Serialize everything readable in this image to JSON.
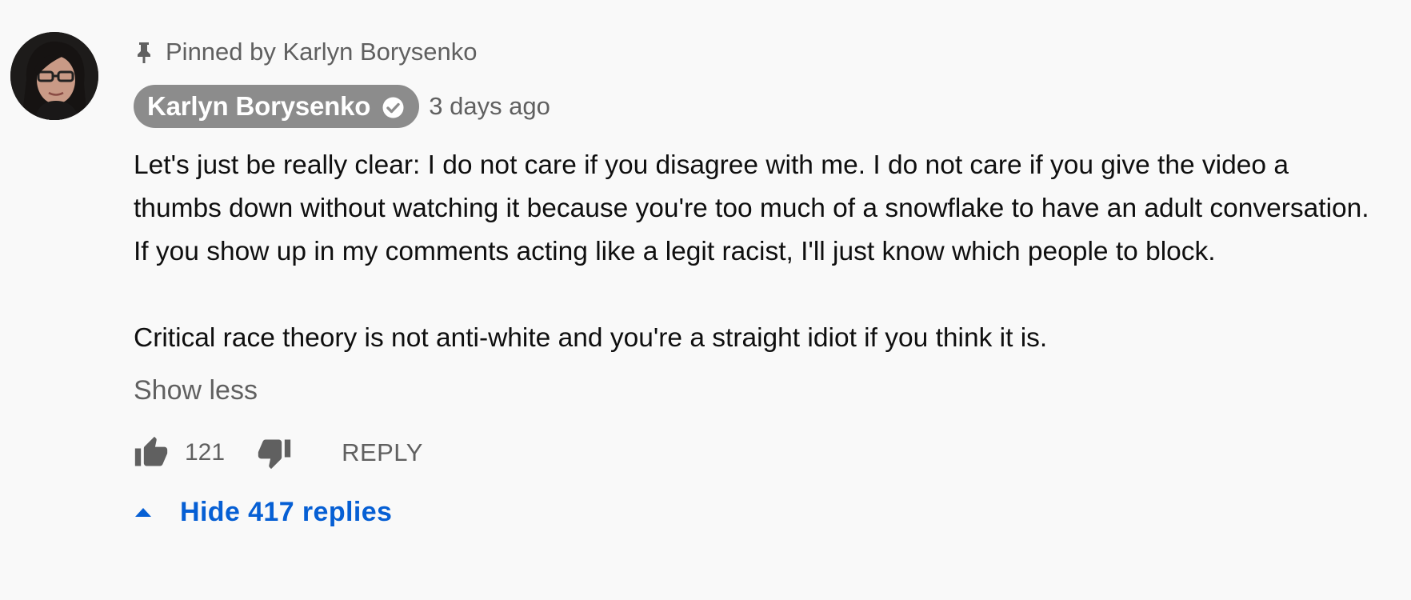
{
  "comment": {
    "pinned_text": "Pinned by Karlyn Borysenko",
    "author": "Karlyn Borysenko",
    "timestamp": "3 days ago",
    "paragraphs": [
      "Let's just be really clear: I do not care if you disagree with me. I do not care if you give the video a thumbs down without watching it because you're too much of a snowflake to have an adult conversation. If you show up in my comments acting like a legit racist, I'll just know which people to block.",
      "Critical race theory is not anti-white and you're a straight idiot if you think it is."
    ],
    "show_less": "Show less",
    "like_count": "121",
    "reply_label": "REPLY",
    "replies_toggle": "Hide 417 replies"
  },
  "icons": {
    "pin": "pin-icon",
    "verified": "verified-checkmark-icon",
    "like": "thumbs-up-icon",
    "dislike": "thumbs-down-icon",
    "replies_caret": "caret-up-icon"
  },
  "colors": {
    "background": "#f9f9f9",
    "text_primary": "#0f0f0f",
    "text_secondary": "#606060",
    "author_badge": "#8c8c8c",
    "link_blue": "#065fd4"
  }
}
